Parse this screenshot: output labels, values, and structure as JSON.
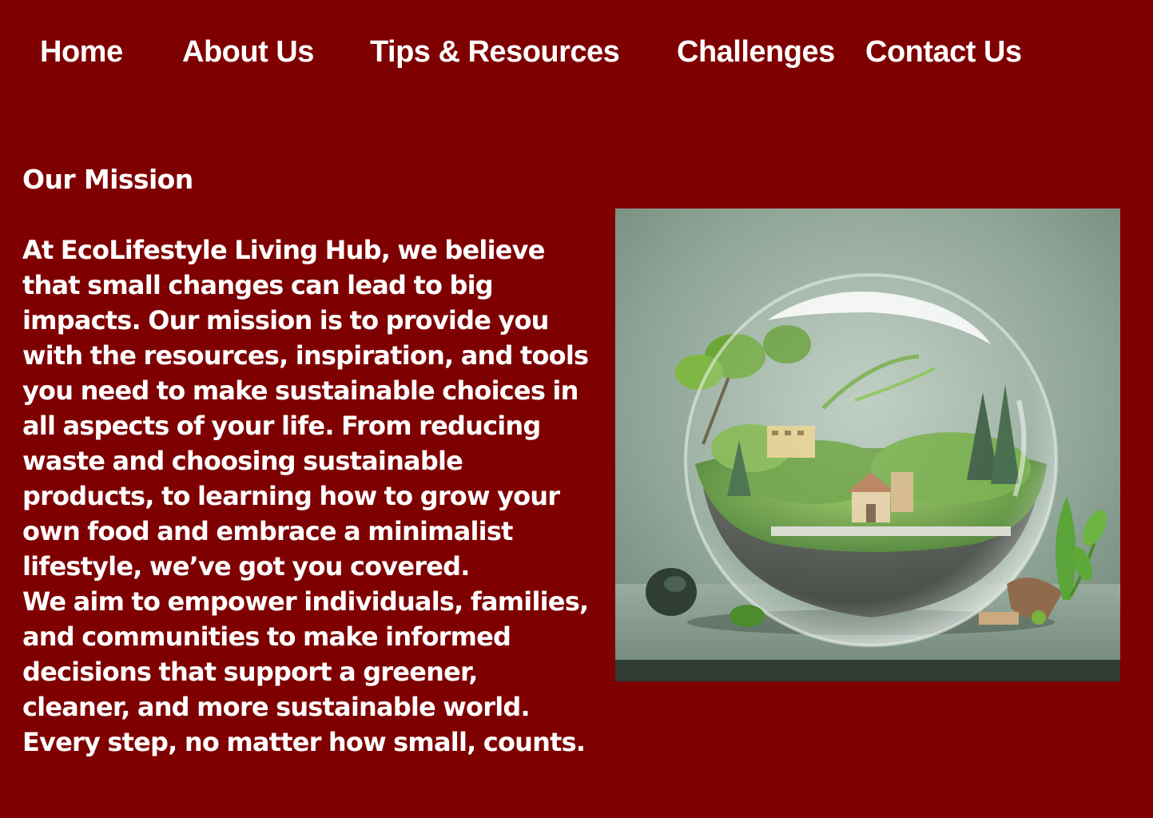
{
  "nav": {
    "items": [
      {
        "label": "Home"
      },
      {
        "label": "About Us"
      },
      {
        "label": "Tips & Resources"
      },
      {
        "label": "Challenges"
      },
      {
        "label": "Contact Us"
      }
    ]
  },
  "mission": {
    "title": "Our Mission",
    "lines": [
      "At EcoLifestyle Living Hub, we believe",
      "that small changes can lead to big",
      "impacts. Our mission is to provide you",
      "with the resources, inspiration, and tools",
      "you need to make sustainable choices in",
      "all aspects of your life. From reducing",
      "waste and choosing sustainable",
      "products, to learning how to grow your",
      "own food and embrace a minimalist",
      "lifestyle, we’ve got you covered.",
      "We aim to empower individuals, families,",
      "and communities to make informed",
      "decisions that support a greener,",
      "cleaner, and more sustainable world.",
      "Every step, no matter how small, counts."
    ]
  },
  "colors": {
    "background": "#7f0000",
    "text": "#ffffff"
  }
}
